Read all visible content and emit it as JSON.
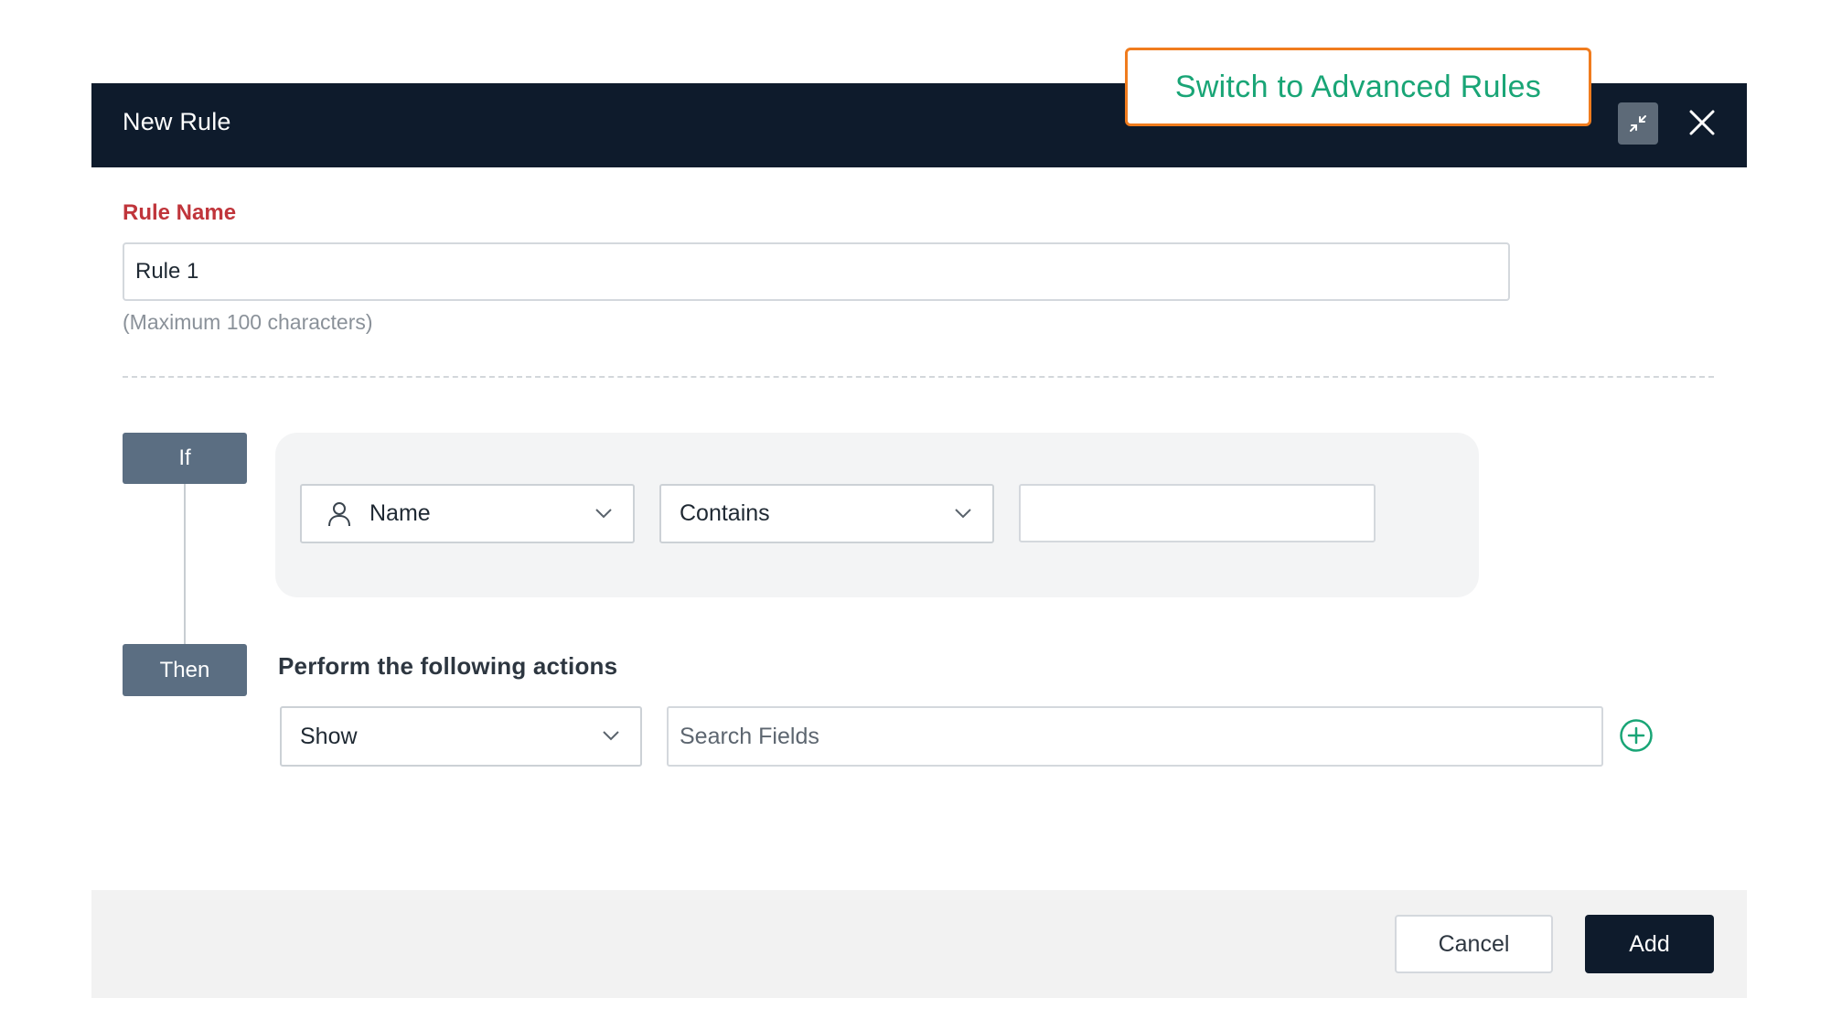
{
  "header": {
    "title": "New Rule",
    "collapse_icon": "collapse-arrows-icon",
    "close_icon": "close-icon"
  },
  "advanced_rules_link": "Switch to Advanced Rules",
  "rule_name": {
    "label": "Rule Name",
    "value": "Rule 1",
    "hint": "(Maximum 100 characters)"
  },
  "condition": {
    "tag": "If",
    "field": {
      "icon": "person-icon",
      "value": "Name"
    },
    "operator": {
      "value": "Contains"
    },
    "value": ""
  },
  "actions": {
    "tag": "Then",
    "title": "Perform the following actions",
    "action": {
      "value": "Show"
    },
    "search_placeholder": "Search Fields",
    "add_icon": "plus-circle-icon"
  },
  "footer": {
    "cancel_label": "Cancel",
    "add_label": "Add"
  },
  "colors": {
    "header_bg": "#0e1b2c",
    "accent_green": "#19a576",
    "callout_border": "#f07c1e",
    "label_red": "#c0353b",
    "tag_bg": "#5b6e82"
  }
}
